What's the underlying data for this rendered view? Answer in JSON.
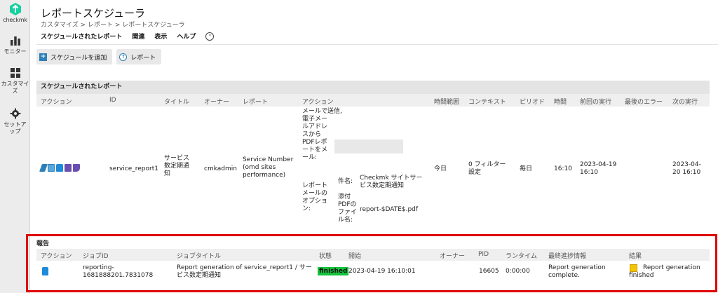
{
  "sidebar": {
    "logo_text": "checkmk",
    "items": [
      {
        "label": "モニター",
        "icon": "bar-chart-icon"
      },
      {
        "label": "カスタマイズ",
        "icon": "grid-icon"
      },
      {
        "label": "セットアップ",
        "icon": "gear-icon"
      }
    ]
  },
  "header": {
    "title": "レポートスケジューラ",
    "breadcrumb": "カスタマイズ > レポート > レポートスケジューラ"
  },
  "menu": [
    "スケジュールされたレポート",
    "関連",
    "表示",
    "ヘルプ"
  ],
  "buttons": {
    "add": "スケジュールを追加",
    "report": "レポート"
  },
  "scheduled": {
    "section_title": "スケジュールされたレポート",
    "columns": [
      "アクション",
      "ID",
      "タイトル",
      "オーナー",
      "レポート",
      "アクション",
      "時間範囲",
      "コンテキスト",
      "ピリオド",
      "時間",
      "前回の実行",
      "最後のエラー",
      "次の実行"
    ],
    "row": {
      "id": "service_report1",
      "title_lines": [
        "サービス",
        "数定期通",
        "知"
      ],
      "owner": "cmkadmin",
      "report_lines": [
        "Service Number",
        "(omd sites",
        "performance)"
      ],
      "action_lines": [
        "メールで送信,",
        "電子メー",
        "ルアドレ",
        "スから",
        "PDFレポ",
        "ートをメ",
        "ール:"
      ],
      "options_lines": [
        "レポート",
        "メールの",
        "オプショ",
        "ン:"
      ],
      "subject_label": "件名:",
      "subject_lines": [
        "Checkmk サイトサー",
        "ビス数定期通知"
      ],
      "attach_label_lines": [
        "添付",
        "PDFの",
        "ファイ",
        "ル名:"
      ],
      "attach_value": "report-$DATE$.pdf",
      "time_range": "今日",
      "context_lines": [
        "0 フィルター",
        "設定"
      ],
      "period": "毎日",
      "time": "16:10",
      "last_run_lines": [
        "2023-04-19",
        "16:10"
      ],
      "last_error": "",
      "next_run_lines": [
        "2023-04-",
        "20 16:10"
      ]
    }
  },
  "reports": {
    "section_title": "報告",
    "columns": [
      "アクション",
      "ジョブID",
      "ジョブタイトル",
      "状態",
      "開始",
      "オーナー",
      "PID",
      "ランタイム",
      "最終進捗情報",
      "結果"
    ],
    "row": {
      "job_id_lines": [
        "reporting-",
        "1681888201.7831078"
      ],
      "job_title_lines": [
        "Report generation of service_report1 / サー",
        "ビス数定期通知"
      ],
      "state": "finished",
      "start": "2023-04-19 16:10:01",
      "owner": "",
      "pid": "16605",
      "runtime": "0:00:00",
      "progress_lines": [
        "Report generation",
        "complete."
      ],
      "result_lines": [
        "Report generation",
        "finished"
      ]
    }
  },
  "colors": {
    "accent": "#2d7fb8",
    "finished": "#14c23c",
    "highlight_box": "#e00000"
  }
}
